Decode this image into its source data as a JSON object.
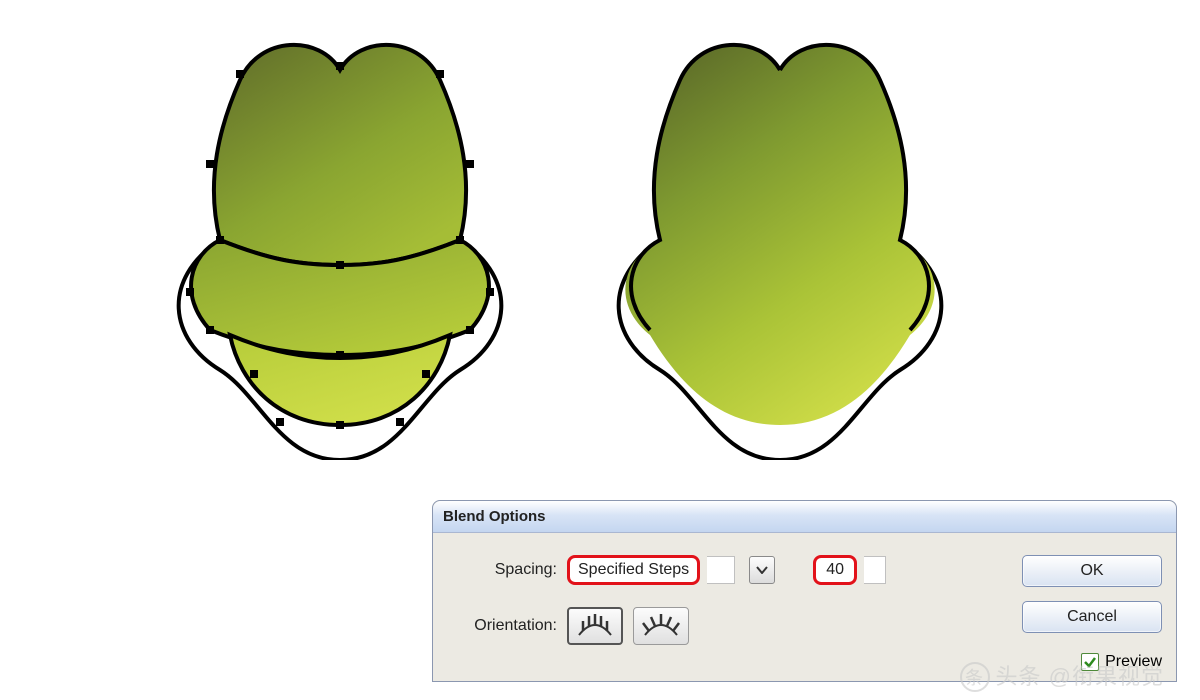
{
  "dialog": {
    "title": "Blend Options",
    "spacing_label": "Spacing:",
    "spacing_mode": "Specified Steps",
    "spacing_value": "40",
    "orientation_label": "Orientation:",
    "ok_label": "OK",
    "cancel_label": "Cancel",
    "preview_label": "Preview",
    "preview_checked": true
  },
  "watermark": {
    "text": "头条 @衔果视觉"
  },
  "shapes": {
    "left": {
      "selected": true
    },
    "right": {
      "selected": false
    }
  },
  "icons": {
    "chevron_down": "chevron-down-icon",
    "orient_align_page": "orient-align-page-icon",
    "orient_align_path": "orient-align-path-icon",
    "checkmark": "checkmark-icon"
  }
}
